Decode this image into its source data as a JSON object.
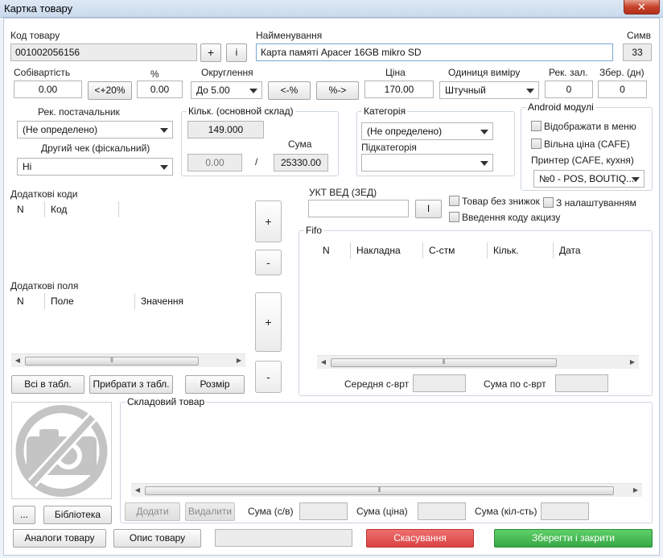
{
  "window": {
    "title": "Картка товару",
    "close": "✕"
  },
  "code": {
    "label": "Код товару",
    "value": "001002056156",
    "plus": "+",
    "info": "i"
  },
  "name": {
    "label": "Найменування",
    "value": "Карта памяті Apacer 16GB mikro SD"
  },
  "symbols": {
    "label": "Симв",
    "value": "33"
  },
  "cost": {
    "label": "Собівартість",
    "value": "0.00",
    "btn": "<+20%"
  },
  "percent": {
    "label": "%",
    "value": "0.00"
  },
  "rounding": {
    "label": "Округлення",
    "value": "До 5.00"
  },
  "btn_minus_percent": "<-%",
  "btn_percent_arrow": "%->",
  "price": {
    "label": "Ціна",
    "value": "170.00"
  },
  "unit": {
    "label": "Одиниця виміру",
    "value": "Штучный"
  },
  "rec_rest": {
    "label": "Рек. зал.",
    "value": "0"
  },
  "stored_days": {
    "label": "Збер. (дн)",
    "value": "0"
  },
  "supplier": {
    "label": "Рек. постачальник",
    "value": "(Не определено)"
  },
  "other_check": {
    "label": "Другий чек (фіскальний)",
    "value": "Ні"
  },
  "quantity": {
    "label": "Кільк. (основной склад)",
    "value": "149.000",
    "sum_label": "Сума",
    "small_value": "0.00",
    "slash": "/",
    "sum_value": "25330.00"
  },
  "category": {
    "label": "Категорія",
    "value": "(Не определено)",
    "sub_label": "Підкатегорія",
    "sub_value": ""
  },
  "android": {
    "label": "Android модулі",
    "show_menu": "Відображати в меню",
    "free_price": "Вільна ціна (CAFE)",
    "printer_label": "Принтер (CAFE, кухня)",
    "printer_value": "№0 - POS, BOUTIQ..."
  },
  "extra_codes": {
    "label": "Додаткові коди",
    "columns": [
      "N",
      "Код"
    ]
  },
  "extra_fields": {
    "label": "Додаткові поля",
    "columns": [
      "N",
      "Поле",
      "Значення"
    ]
  },
  "side_buttons": {
    "add": "+",
    "remove": "-"
  },
  "uktzed": {
    "label": "УКТ ВЕД (ЗЕД)",
    "value": "",
    "btn": "I"
  },
  "options": {
    "no_discount": "Товар без знижок",
    "with_settings": "З налаштуванням",
    "excise": "Введення коду акцизу"
  },
  "fifo": {
    "label": "Fifo",
    "columns": [
      "N",
      "Накладна",
      "С-стм",
      "Кільк.",
      "Дата"
    ],
    "avg_label": "Середня с-врт",
    "avg_value": "",
    "sum_label": "Сума по с-врт",
    "sum_value": ""
  },
  "left_buttons": {
    "all_to_table": "Всі в табл.",
    "remove_from_table": "Прибрати з табл.",
    "size": "Розмір"
  },
  "warehouse": {
    "label": "Складовий товар",
    "add": "Додати",
    "delete": "Видалити",
    "sum_cv_label": "Сума (с/в)",
    "sum_price_label": "Сума (ціна)",
    "sum_qty_label": "Сума (кіл-сть)"
  },
  "image_buttons": {
    "more": "...",
    "library": "Бібліотека"
  },
  "bottom": {
    "analogs": "Аналоги товару",
    "description": "Опис товару",
    "cancel": "Скасування",
    "save_close": "Зберегти і закрити"
  },
  "scroll_grip": "⦀",
  "colors": {
    "cancel": "#d94444",
    "save": "#37a844"
  }
}
